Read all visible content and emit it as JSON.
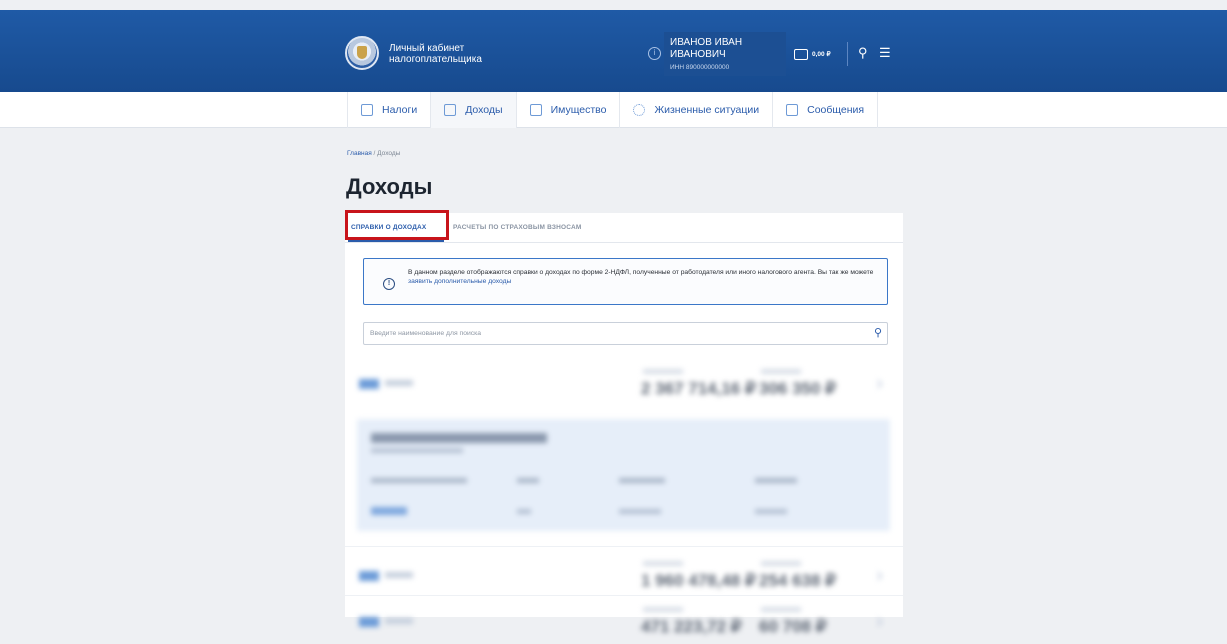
{
  "header": {
    "brand_line1": "Личный кабинет",
    "brand_line2": "налогоплательщика",
    "user_name": "ИВАНОВ ИВАН ИВАНОВИЧ",
    "user_inn": "ИНН 890000000000",
    "balance": "0,00 ₽"
  },
  "nav": {
    "items": [
      {
        "label": "Налоги"
      },
      {
        "label": "Доходы"
      },
      {
        "label": "Имущество"
      },
      {
        "label": "Жизненные ситуации"
      },
      {
        "label": "Сообщения"
      }
    ]
  },
  "breadcrumb": {
    "home": "Главная",
    "separator": " / ",
    "current": "Доходы"
  },
  "page": {
    "title": "Доходы"
  },
  "tabs": {
    "income": "СПРАВКИ О ДОХОДАХ",
    "insurance": "РАСЧЕТЫ ПО СТРАХОВЫМ ВЗНОСАМ"
  },
  "info": {
    "text": "В данном разделе отображаются справки о доходах по форме 2-НДФЛ, полученные от работодателя или иного налогового агента. Вы так же можете ",
    "link": "заявить дополнительные доходы"
  },
  "search": {
    "placeholder": "Введите наименование для поиска"
  },
  "rows": [
    {
      "amount1": "2 367 714,16 ₽",
      "amount2": "306 350 ₽"
    },
    {
      "amount1": "1 960 478,48 ₽",
      "amount2": "254 638 ₽"
    },
    {
      "amount1": "471 223,72 ₽",
      "amount2": "60 708 ₽"
    }
  ],
  "icons": {
    "user": "info-circle-icon",
    "wallet": "wallet-icon",
    "search": "search-icon",
    "menu": "menu-icon"
  },
  "colors": {
    "header": "#1f5aa6",
    "accent": "#2b5cab",
    "highlight": "#c8141b"
  }
}
